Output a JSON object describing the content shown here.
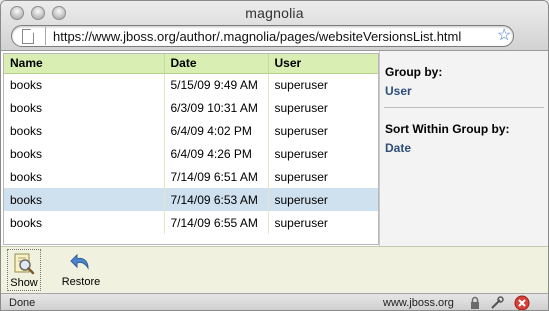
{
  "window": {
    "title": "magnolia"
  },
  "addressbar": {
    "url": "https://www.jboss.org/author/.magnolia/pages/websiteVersionsList.html"
  },
  "table": {
    "columns": [
      "Name",
      "Date",
      "User"
    ],
    "rows": [
      {
        "name": "books",
        "date": "5/15/09 9:49 AM",
        "user": "superuser"
      },
      {
        "name": "books",
        "date": "6/3/09 10:31 AM",
        "user": "superuser"
      },
      {
        "name": "books",
        "date": "6/4/09 4:02 PM",
        "user": "superuser"
      },
      {
        "name": "books",
        "date": "6/4/09 4:26 PM",
        "user": "superuser"
      },
      {
        "name": "books",
        "date": "7/14/09 6:51 AM",
        "user": "superuser"
      },
      {
        "name": "books",
        "date": "7/14/09 6:53 AM",
        "user": "superuser",
        "selected": true
      },
      {
        "name": "books",
        "date": "7/14/09 6:55 AM",
        "user": "superuser"
      }
    ]
  },
  "sidebar": {
    "group_by_label": "Group by:",
    "group_by_value": "User",
    "sort_label": "Sort Within Group by:",
    "sort_value": "Date"
  },
  "toolbar": {
    "show_label": "Show",
    "restore_label": "Restore"
  },
  "statusbar": {
    "status": "Done",
    "host": "www.jboss.org"
  },
  "colors": {
    "header_bg": "#d9eeb3",
    "selected_row": "#cfe0ee",
    "link_blue": "#2d4f7a",
    "toolbar_bg": "#f1f1df"
  },
  "icons": [
    "page-icon",
    "bookmark-star-icon",
    "show-magnifier-icon",
    "restore-arrow-icon",
    "lock-icon",
    "tools-icon",
    "stop-icon"
  ]
}
